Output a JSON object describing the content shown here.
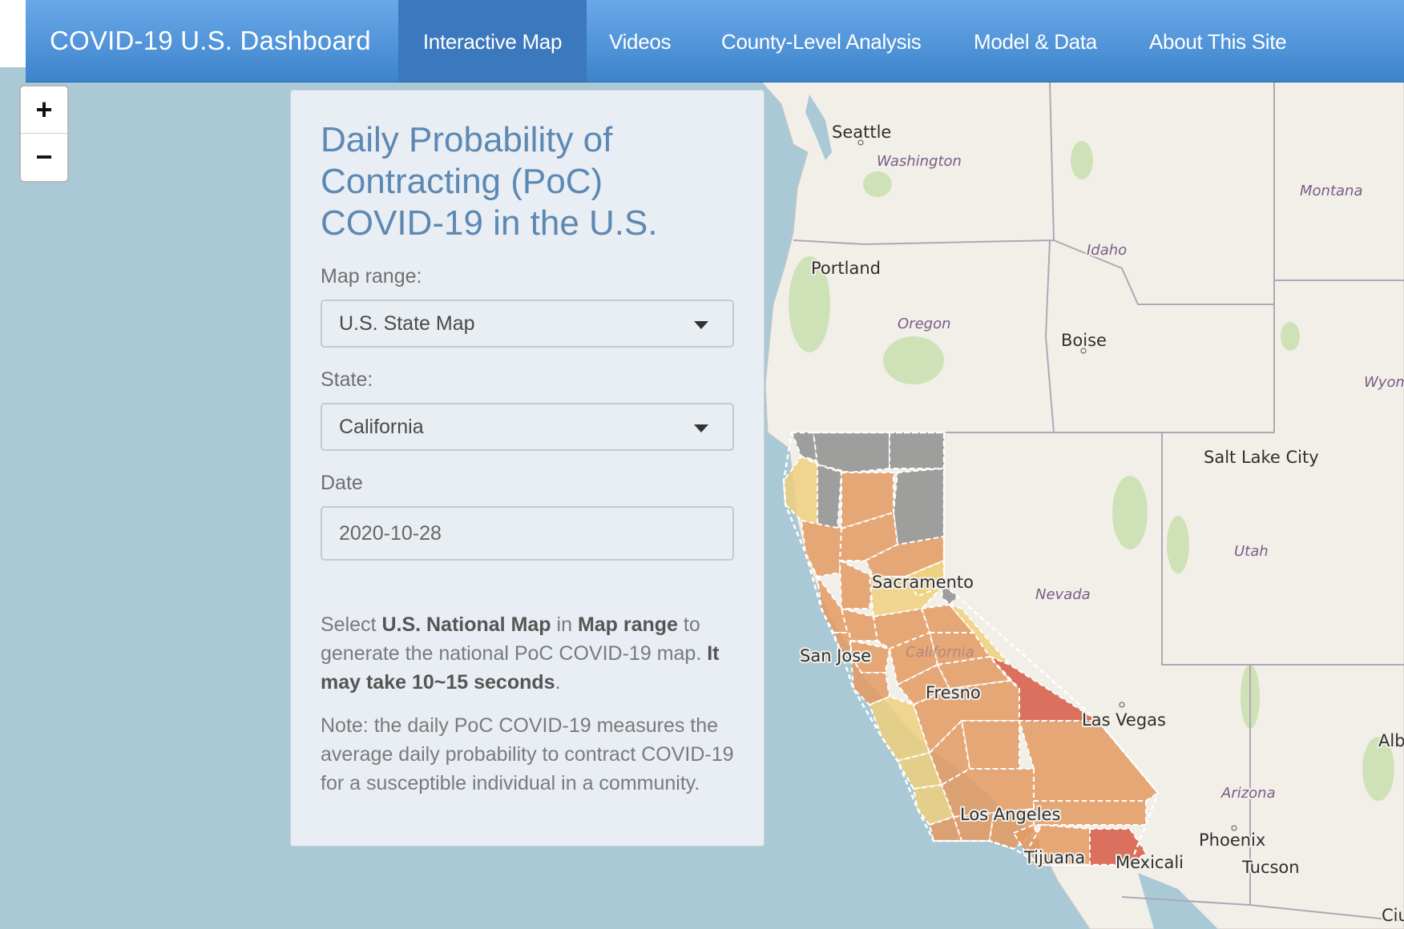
{
  "navbar": {
    "brand": "COVID-19 U.S. Dashboard",
    "items": [
      {
        "label": "Interactive Map",
        "active": true
      },
      {
        "label": "Videos",
        "active": false
      },
      {
        "label": "County-Level Analysis",
        "active": false
      },
      {
        "label": "Model & Data",
        "active": false
      },
      {
        "label": "About This Site",
        "active": false
      }
    ]
  },
  "zoom": {
    "in": "+",
    "out": "−"
  },
  "panel": {
    "title": "Daily Probability of Contracting (PoC) COVID-19 in the U.S.",
    "map_range": {
      "label": "Map range:",
      "value": "U.S. State Map"
    },
    "state": {
      "label": "State:",
      "value": "California"
    },
    "date": {
      "label": "Date",
      "value": "2020-10-28"
    },
    "instructions": {
      "t1": "Select ",
      "b1": "U.S. National Map",
      "t2": " in ",
      "b2": "Map range",
      "t3": " to generate the national PoC COVID-19 map. ",
      "b3": "It may take 10~15 seconds",
      "t4": "."
    },
    "note": "Note: the daily PoC COVID-19 measures the average daily probability to contract COVID-19 for a susceptible individual in a community."
  },
  "map": {
    "cities": [
      "Seattle",
      "Portland",
      "Boise",
      "Salt Lake City",
      "San Jose",
      "Fresno",
      "Sacramento",
      "Los Angeles",
      "Las Vegas",
      "Tijuana",
      "Mexicali",
      "Phoenix",
      "Tucson",
      "Alb",
      "Ciu"
    ],
    "states": [
      "Washington",
      "Montana",
      "Idaho",
      "Oregon",
      "Wyom",
      "Nevada",
      "Utah",
      "Arizona",
      "California"
    ],
    "colors": {
      "water": "#aac9d6",
      "land": "#f2efe9",
      "no_data": "#8f8f8f",
      "low": "#efd07c",
      "medium": "#e49a62",
      "high": "#d9624f"
    }
  }
}
